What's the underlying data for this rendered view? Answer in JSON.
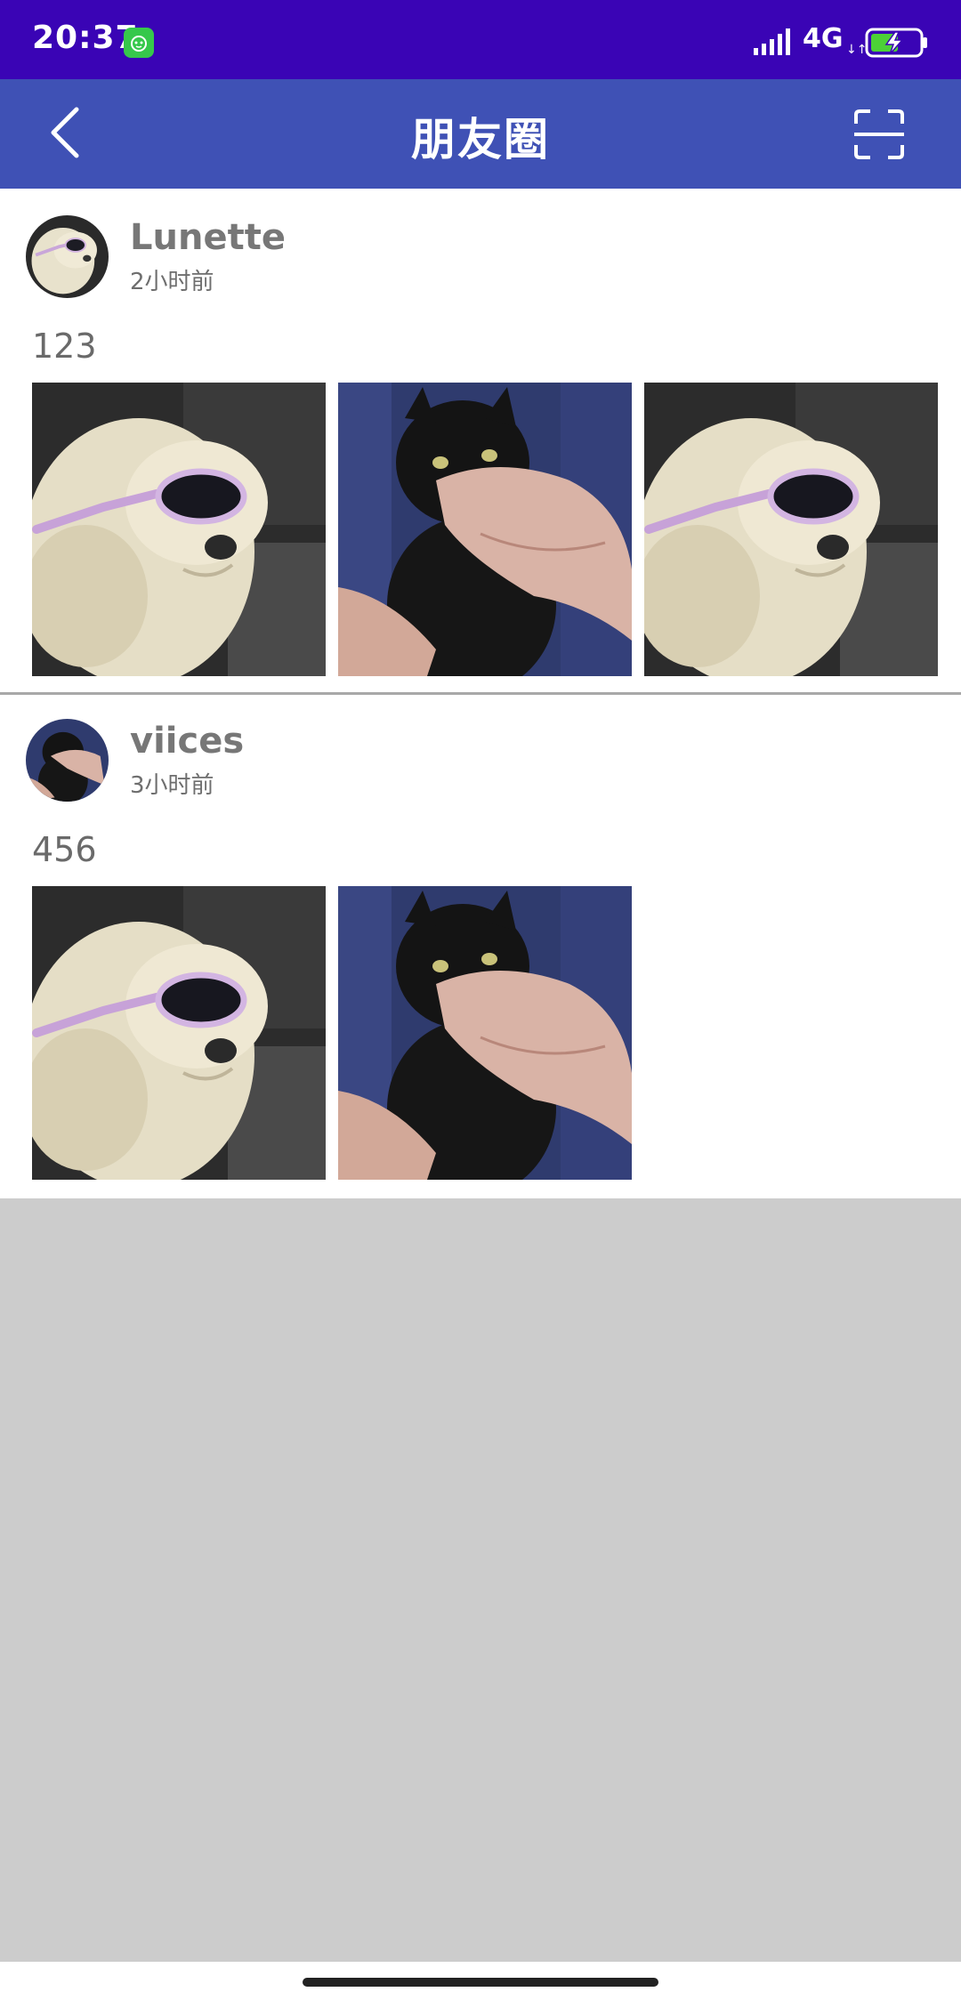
{
  "status_bar": {
    "time": "20:37",
    "network": "4G",
    "network_arrows": "↓↑",
    "background": "#3a04b5"
  },
  "app_bar": {
    "title": "朋友圈",
    "background": "#3f51b5",
    "back_icon": "chevron-left-icon",
    "scan_icon": "scan-icon"
  },
  "posts": [
    {
      "username": "Lunette",
      "time": "2小时前",
      "text": "123",
      "avatar": "dog-sunglasses",
      "photos": [
        "dog-sunglasses",
        "black-cat-held",
        "dog-sunglasses"
      ]
    },
    {
      "username": "viices",
      "time": "3小时前",
      "text": "456",
      "avatar": "black-cat-held",
      "photos": [
        "dog-sunglasses",
        "black-cat-held"
      ]
    }
  ],
  "colors": {
    "page_background": "#cccccc",
    "card_background": "#ffffff",
    "username": "#777777",
    "divider": "#a8a8a8"
  }
}
